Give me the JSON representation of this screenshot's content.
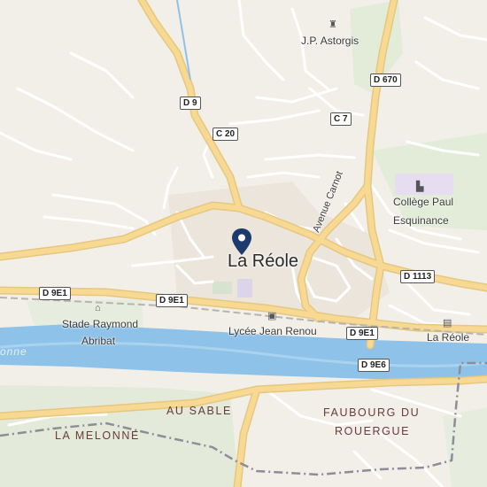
{
  "map": {
    "town": "La Réole",
    "places": {
      "astorgis": "J.P. Astorgis",
      "college_line1": "Collège Paul",
      "college_line2": "Esquinance",
      "stade_line1": "Stade Raymond",
      "stade_line2": "Abribat",
      "lycee": "Lycée Jean Renou",
      "station": "La Réole",
      "avenue": "Avenue Carnot"
    },
    "localities": {
      "au_sable": "AU SABLE",
      "la_melonne": "LA MELONNE",
      "faubourg_line1": "FAUBOURG DU",
      "faubourg_line2": "ROUERGUE"
    },
    "road_shields": {
      "d9": "D 9",
      "c20": "C 20",
      "c7": "C 7",
      "d670": "D 670",
      "d1113": "D 1113",
      "d9e1_left": "D 9E1",
      "d9e1_mid": "D 9E1",
      "d9e1_right": "D 9E1",
      "d9e6": "D 9E6"
    },
    "river_label": "onne",
    "icons": {
      "pin": "location-pin-icon",
      "astorgis": "shop-icon",
      "college": "school-icon",
      "stade": "sports-icon",
      "lycee": "bus-icon",
      "station": "train-icon"
    },
    "colors": {
      "land": "#f2efe9",
      "water": "#8fc2e8",
      "major_road": "#f5d58f",
      "minor_road": "#ffffff",
      "park": "#dfe9d3",
      "pin": "#1d3a6e",
      "boundary": "#8d8d9a"
    }
  }
}
